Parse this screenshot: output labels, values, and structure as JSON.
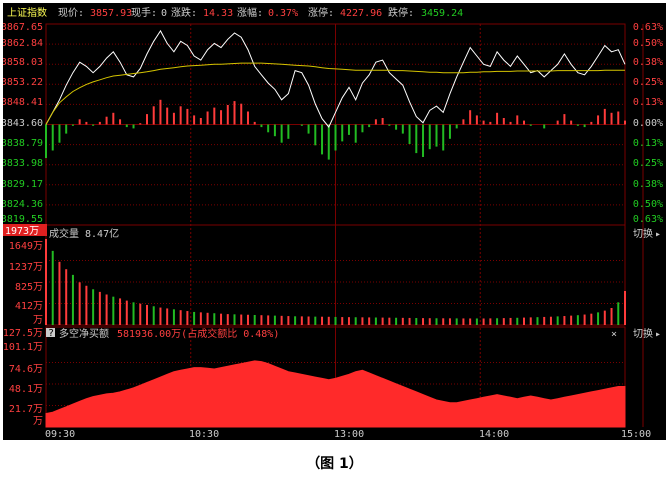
{
  "header": {
    "index_name": "上证指数",
    "price_label": "现价:",
    "price_value": "3857.93",
    "hand_label": "现手:",
    "hand_value": "0",
    "change_label": "涨跌:",
    "change_value": "14.33",
    "pct_label": "涨幅:",
    "pct_value": "0.37%",
    "limit_up_label": "涨停:",
    "limit_up_value": "4227.96",
    "limit_down_label": "跌停:",
    "limit_down_value": "3459.24"
  },
  "price_axis_left": [
    "3867.65",
    "3862.84",
    "3858.03",
    "3853.22",
    "3848.41",
    "3843.60",
    "3838.79",
    "3833.98",
    "3829.17",
    "3824.36",
    "3819.55"
  ],
  "price_axis_right": [
    "0.63%",
    "0.50%",
    "0.38%",
    "0.25%",
    "0.13%",
    "0.00%",
    "0.13%",
    "0.25%",
    "0.38%",
    "0.50%",
    "0.63%"
  ],
  "volume_panel": {
    "badge": "1973万",
    "title": "成交量 8.47亿",
    "switch_label": "切换",
    "axis": [
      "1649万",
      "1237万",
      "825万",
      "412万",
      "万"
    ]
  },
  "net_panel": {
    "axis_top": "127.5万",
    "marker": "?",
    "title": "多空净买额",
    "value_text": "581936.00万(占成交额比 0.48%)",
    "close_symbol": "×",
    "switch_label": "切换",
    "axis": [
      "101.1万",
      "74.6万",
      "48.1万",
      "21.7万",
      "万"
    ]
  },
  "time_axis": [
    "09:30",
    "10:30",
    "13:00",
    "14:00",
    "15:00"
  ],
  "caption": "（图 1）",
  "colors": {
    "background": "#000000",
    "grid": "#7a0000",
    "up": "#ff3b3b",
    "down": "#22bb22",
    "price_line": "#ffffff",
    "avg_line": "#d4c400",
    "axis_text_up": "#ff4040",
    "axis_text_down": "#22cc22",
    "title_text": "#ffff55",
    "value_text": "#ff4040"
  },
  "chart_data": [
    {
      "type": "line",
      "series": [
        {
          "name": "现价",
          "values": [
            3843.6,
            3846.5,
            3849.5,
            3853.0,
            3856.0,
            3858.5,
            3857.5,
            3856.0,
            3857.5,
            3859.5,
            3861.0,
            3858.5,
            3855.5,
            3855.0,
            3857.0,
            3860.5,
            3863.5,
            3866.0,
            3863.0,
            3861.0,
            3863.5,
            3862.5,
            3860.0,
            3859.0,
            3861.5,
            3863.0,
            3862.0,
            3864.0,
            3865.5,
            3864.5,
            3861.5,
            3857.5,
            3855.5,
            3853.5,
            3852.0,
            3849.5,
            3851.0,
            3856.5,
            3856.0,
            3853.0,
            3848.5,
            3845.0,
            3843.0,
            3846.5,
            3850.0,
            3852.5,
            3849.5,
            3853.5,
            3855.5,
            3858.5,
            3859.0,
            3856.0,
            3854.5,
            3853.0,
            3849.0,
            3845.5,
            3844.0,
            3847.0,
            3848.0,
            3846.5,
            3851.0,
            3855.0,
            3858.5,
            3862.0,
            3860.0,
            3858.0,
            3857.5,
            3861.0,
            3859.0,
            3857.5,
            3860.0,
            3858.0,
            3856.0,
            3856.5,
            3855.0,
            3856.5,
            3858.0,
            3860.5,
            3858.0,
            3856.0,
            3855.5,
            3857.5,
            3860.0,
            3862.5,
            3861.0,
            3861.5,
            3858.0
          ]
        },
        {
          "name": "均价",
          "values": [
            3843.6,
            3846.5,
            3848.8,
            3850.2,
            3851.5,
            3852.4,
            3853.2,
            3853.8,
            3854.3,
            3854.8,
            3855.2,
            3855.4,
            3855.6,
            3855.8,
            3856.0,
            3856.2,
            3856.5,
            3856.8,
            3857.0,
            3857.2,
            3857.4,
            3857.6,
            3857.7,
            3857.8,
            3857.9,
            3858.0,
            3858.0,
            3858.1,
            3858.2,
            3858.3,
            3858.3,
            3858.3,
            3858.3,
            3858.2,
            3858.1,
            3858.0,
            3857.9,
            3857.8,
            3857.7,
            3857.6,
            3857.4,
            3857.2,
            3857.0,
            3856.9,
            3856.8,
            3856.7,
            3856.6,
            3856.6,
            3856.6,
            3856.6,
            3856.6,
            3856.6,
            3856.5,
            3856.5,
            3856.4,
            3856.3,
            3856.2,
            3856.1,
            3856.1,
            3856.0,
            3856.0,
            3856.0,
            3856.0,
            3856.1,
            3856.1,
            3856.2,
            3856.2,
            3856.3,
            3856.3,
            3856.3,
            3856.4,
            3856.4,
            3856.4,
            3856.4,
            3856.4,
            3856.4,
            3856.5,
            3856.5,
            3856.5,
            3856.5,
            3856.5,
            3856.5,
            3856.5,
            3856.6,
            3856.6,
            3856.6,
            3856.6
          ]
        }
      ],
      "ylim": [
        3819.55,
        3867.65
      ]
    },
    {
      "type": "bar",
      "values": [
        1973,
        1700,
        1450,
        1280,
        1150,
        980,
        900,
        820,
        760,
        700,
        650,
        610,
        560,
        520,
        490,
        460,
        430,
        400,
        380,
        360,
        340,
        320,
        300,
        290,
        280,
        270,
        260,
        250,
        245,
        240,
        235,
        230,
        225,
        220,
        215,
        210,
        205,
        200,
        198,
        195,
        192,
        190,
        188,
        185,
        182,
        180,
        178,
        176,
        174,
        172,
        170,
        168,
        166,
        164,
        162,
        160,
        158,
        156,
        155,
        154,
        153,
        152,
        151,
        150,
        150,
        150,
        152,
        155,
        158,
        162,
        165,
        170,
        175,
        180,
        185,
        190,
        198,
        206,
        215,
        225,
        240,
        260,
        290,
        330,
        390,
        520,
        780
      ],
      "ylim": [
        0,
        1973
      ]
    },
    {
      "type": "area",
      "values": [
        20,
        22,
        26,
        30,
        34,
        38,
        42,
        45,
        47,
        49,
        50,
        52,
        55,
        58,
        62,
        66,
        70,
        74,
        78,
        82,
        84,
        86,
        88,
        88,
        87,
        86,
        88,
        90,
        92,
        94,
        96,
        98,
        97,
        94,
        90,
        86,
        82,
        80,
        78,
        76,
        74,
        72,
        70,
        72,
        75,
        78,
        82,
        84,
        80,
        76,
        72,
        68,
        64,
        60,
        56,
        52,
        48,
        44,
        40,
        38,
        36,
        36,
        38,
        40,
        42,
        44,
        46,
        48,
        46,
        44,
        42,
        44,
        46,
        44,
        42,
        40,
        42,
        44,
        46,
        48,
        50,
        52,
        54,
        56,
        58,
        60,
        60
      ],
      "ylim": [
        0,
        127.5
      ]
    }
  ]
}
